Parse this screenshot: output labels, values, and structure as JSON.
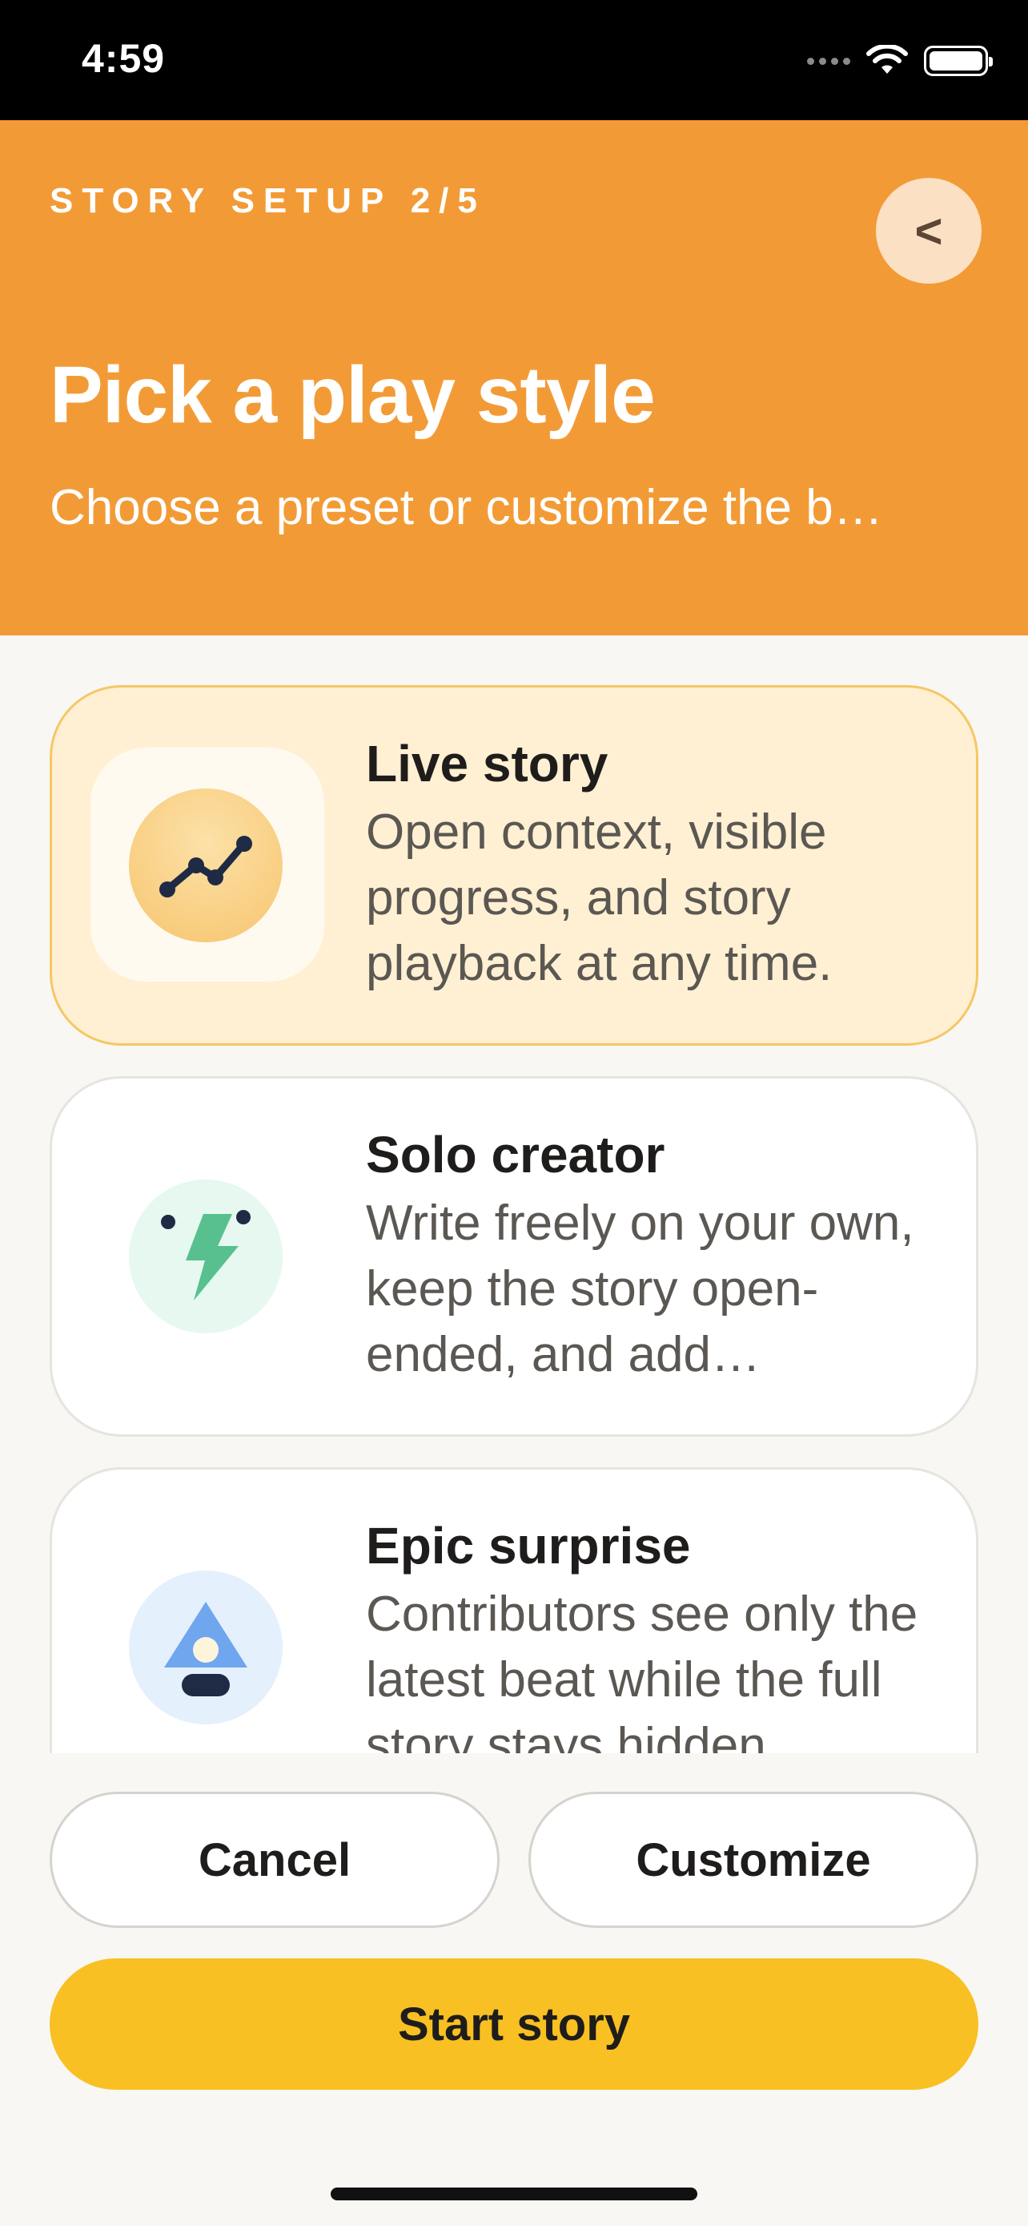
{
  "status_bar": {
    "time": "4:59"
  },
  "header": {
    "eyebrow": "STORY SETUP 2/5",
    "back_label": "<",
    "title": "Pick a play style",
    "subtitle": "Choose a preset or customize the b…"
  },
  "options": [
    {
      "title": "Live story",
      "description": "Open context, visible progress, and story playback at any time.",
      "icon": "trend-line-icon",
      "selected": true
    },
    {
      "title": "Solo creator",
      "description": "Write freely on your own, keep the story open-ended, and add…",
      "icon": "lightning-bolt-icon",
      "selected": false
    },
    {
      "title": "Epic surprise",
      "description": "Contributors see only the latest beat while the full story stays hidden…",
      "icon": "lamp-icon",
      "selected": false
    }
  ],
  "actions": {
    "cancel_label": "Cancel",
    "customize_label": "Customize",
    "start_label": "Start story"
  },
  "colors": {
    "header": "#f29b36",
    "selected_card": "#fff0d3",
    "primary_button": "#f8c022"
  }
}
